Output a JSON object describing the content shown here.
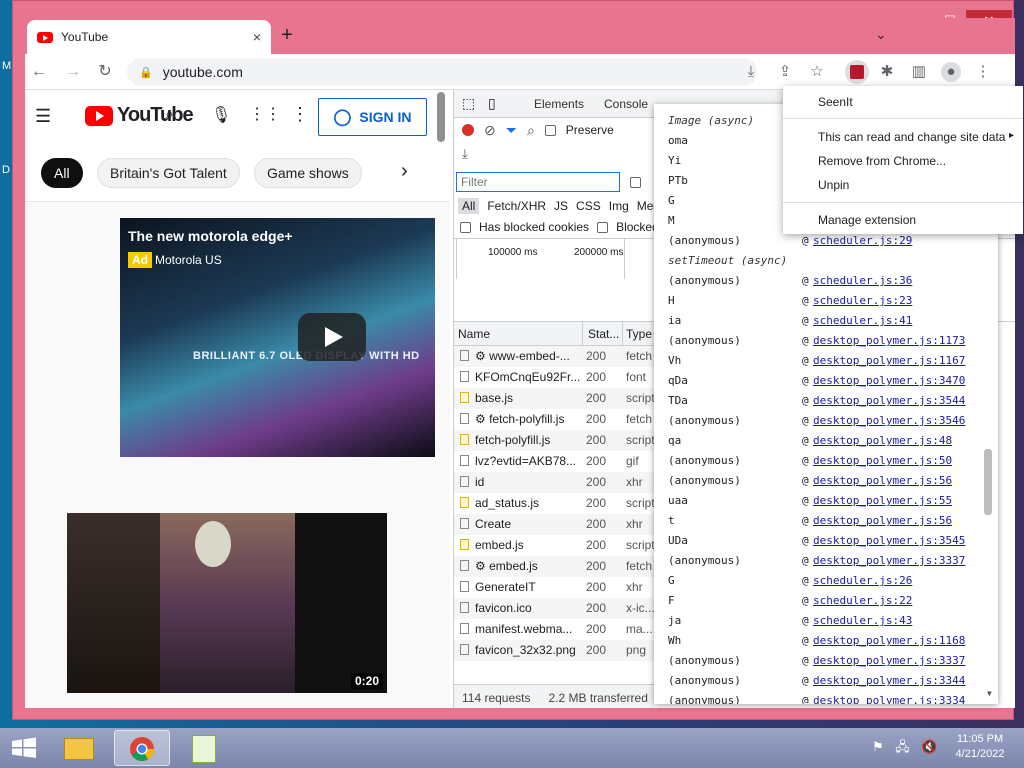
{
  "desktop": {
    "icon_labels": [
      "M",
      "D"
    ]
  },
  "browser": {
    "tab_title": "YouTube",
    "tab_close": "×",
    "new_tab": "+",
    "window_controls": [
      "—",
      "☐",
      "✕"
    ],
    "tabstrip_menu": "⌄",
    "url": "youtube.com",
    "toolbar_icons": [
      "back-icon",
      "forward-icon",
      "reload-icon",
      "lock-icon",
      "install-icon",
      "share-icon",
      "star-icon",
      "seenit-extension-icon",
      "extensions-icon",
      "side-panel-icon",
      "profile-icon",
      "more-icon"
    ]
  },
  "youtube": {
    "logo_text": "YouTube",
    "sign_in": "SIGN IN",
    "chips": [
      "All",
      "Britain's Got Talent",
      "Game shows"
    ],
    "chip_next": "›",
    "video1": {
      "title": "The new motorola edge+",
      "ad_badge": "Ad",
      "advertiser": "Motorola US",
      "overlay_text": "BRILLIANT 6.7 OLED DISPLAY WITH HD"
    },
    "video2": {
      "duration": "0:20"
    }
  },
  "devtools": {
    "tabs": [
      "Elements",
      "Console"
    ],
    "preserve_log": "Preserve",
    "filter_placeholder": "Filter",
    "type_filters": [
      "All",
      "Fetch/XHR",
      "JS",
      "CSS",
      "Img",
      "Med"
    ],
    "has_blocked_cookies": "Has blocked cookies",
    "blocked": "Blocked",
    "timeline_ticks": [
      "100000 ms",
      "200000 ms"
    ],
    "columns": [
      "Name",
      "Stat...",
      "Type"
    ],
    "rows": [
      {
        "name": "www-embed-...",
        "status": "200",
        "type": "fetch",
        "js": false,
        "gear": true
      },
      {
        "name": "KFOmCnqEu92Fr...",
        "status": "200",
        "type": "font",
        "js": false,
        "gear": false
      },
      {
        "name": "base.js",
        "status": "200",
        "type": "script",
        "js": true,
        "gear": false
      },
      {
        "name": "fetch-polyfill.js",
        "status": "200",
        "type": "fetch",
        "js": false,
        "gear": true
      },
      {
        "name": "fetch-polyfill.js",
        "status": "200",
        "type": "script",
        "js": true,
        "gear": false
      },
      {
        "name": "lvz?evtid=AKB78...",
        "status": "200",
        "type": "gif",
        "js": false,
        "gear": false
      },
      {
        "name": "id",
        "status": "200",
        "type": "xhr",
        "js": false,
        "gear": false
      },
      {
        "name": "ad_status.js",
        "status": "200",
        "type": "script",
        "js": true,
        "gear": false
      },
      {
        "name": "Create",
        "status": "200",
        "type": "xhr",
        "js": false,
        "gear": false
      },
      {
        "name": "embed.js",
        "status": "200",
        "type": "script",
        "js": true,
        "gear": false
      },
      {
        "name": "embed.js",
        "status": "200",
        "type": "fetch",
        "js": false,
        "gear": true
      },
      {
        "name": "GenerateIT",
        "status": "200",
        "type": "xhr",
        "js": false,
        "gear": false
      },
      {
        "name": "favicon.ico",
        "status": "200",
        "type": "x-ic...",
        "js": false,
        "gear": false
      },
      {
        "name": "manifest.webma...",
        "status": "200",
        "type": "ma...",
        "js": false,
        "gear": false
      },
      {
        "name": "favicon_32x32.png",
        "status": "200",
        "type": "png",
        "js": false,
        "gear": false
      }
    ],
    "footer_requests": "114 requests",
    "footer_transferred": "2.2 MB transferred"
  },
  "call_stack": [
    {
      "fn": "Image (async)",
      "loc": "",
      "async": true
    },
    {
      "fn": "oma",
      "loc": ""
    },
    {
      "fn": "Yi",
      "loc": ""
    },
    {
      "fn": "PTb",
      "loc": ""
    },
    {
      "fn": "G",
      "loc": ""
    },
    {
      "fn": "M",
      "loc": ""
    },
    {
      "fn": "(anonymous)",
      "loc": "scheduler.js:29"
    },
    {
      "fn": "setTimeout (async)",
      "loc": "",
      "async": true
    },
    {
      "fn": "(anonymous)",
      "loc": "scheduler.js:36"
    },
    {
      "fn": "H",
      "loc": "scheduler.js:23"
    },
    {
      "fn": "ia",
      "loc": "scheduler.js:41"
    },
    {
      "fn": "(anonymous)",
      "loc": "desktop_polymer.js:1173"
    },
    {
      "fn": "Vh",
      "loc": "desktop_polymer.js:1167"
    },
    {
      "fn": "qDa",
      "loc": "desktop_polymer.js:3470"
    },
    {
      "fn": "TDa",
      "loc": "desktop_polymer.js:3544"
    },
    {
      "fn": "(anonymous)",
      "loc": "desktop_polymer.js:3546"
    },
    {
      "fn": "qa",
      "loc": "desktop_polymer.js:48"
    },
    {
      "fn": "(anonymous)",
      "loc": "desktop_polymer.js:50"
    },
    {
      "fn": "(anonymous)",
      "loc": "desktop_polymer.js:56"
    },
    {
      "fn": "uaa",
      "loc": "desktop_polymer.js:55"
    },
    {
      "fn": "t",
      "loc": "desktop_polymer.js:56"
    },
    {
      "fn": "UDa",
      "loc": "desktop_polymer.js:3545"
    },
    {
      "fn": "(anonymous)",
      "loc": "desktop_polymer.js:3337"
    },
    {
      "fn": "G",
      "loc": "scheduler.js:26"
    },
    {
      "fn": "F",
      "loc": "scheduler.js:22"
    },
    {
      "fn": "ja",
      "loc": "scheduler.js:43"
    },
    {
      "fn": "Wh",
      "loc": "desktop_polymer.js:1168"
    },
    {
      "fn": "(anonymous)",
      "loc": "desktop_polymer.js:3337"
    },
    {
      "fn": "(anonymous)",
      "loc": "desktop_polymer.js:3344"
    },
    {
      "fn": "(anonymous)",
      "loc": "desktop_polymer.js:3334"
    }
  ],
  "extension_menu": {
    "name": "SeenIt",
    "items": [
      "This can read and change site data",
      "Remove from Chrome...",
      "Unpin",
      "Manage extension"
    ],
    "submenu_arrow": "▸"
  },
  "taskbar": {
    "apps": [
      "file-explorer",
      "chrome",
      "notepad-plus-plus"
    ],
    "time": "11:05 PM",
    "date": "4/21/2022"
  }
}
